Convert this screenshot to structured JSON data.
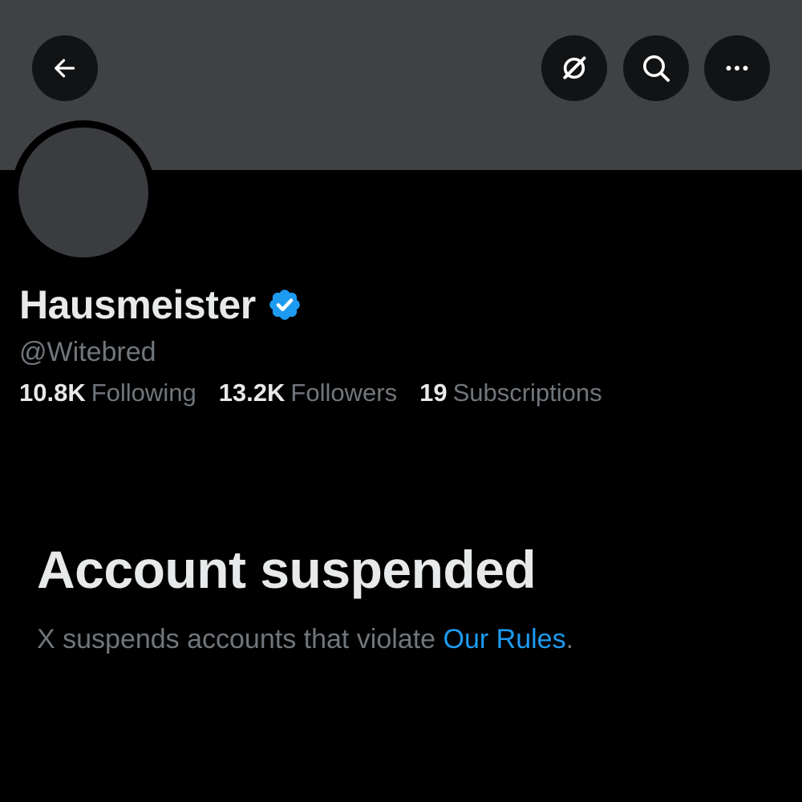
{
  "colors": {
    "background": "#000000",
    "banner": "#3f4145",
    "avatar": "#3a3c40",
    "primary_text": "#e7e9ea",
    "secondary_text": "#71767b",
    "link": "#1d9bf0",
    "verified_badge": "#1d9bf0"
  },
  "header": {
    "back_icon": "arrow-left-icon",
    "grok_icon": "grok-icon",
    "search_icon": "search-icon",
    "more_icon": "more-horizontal-icon"
  },
  "profile": {
    "display_name": "Hausmeister",
    "verified_icon": "verified-badge-icon",
    "handle": "@Witebred",
    "stats": {
      "following_count": "10.8K",
      "following_label": "Following",
      "followers_count": "13.2K",
      "followers_label": "Followers",
      "subscriptions_count": "19",
      "subscriptions_label": "Subscriptions"
    }
  },
  "suspension": {
    "title": "Account suspended",
    "message_prefix": "X suspends accounts that violate ",
    "rules_link": "Our Rules",
    "message_suffix": "."
  }
}
